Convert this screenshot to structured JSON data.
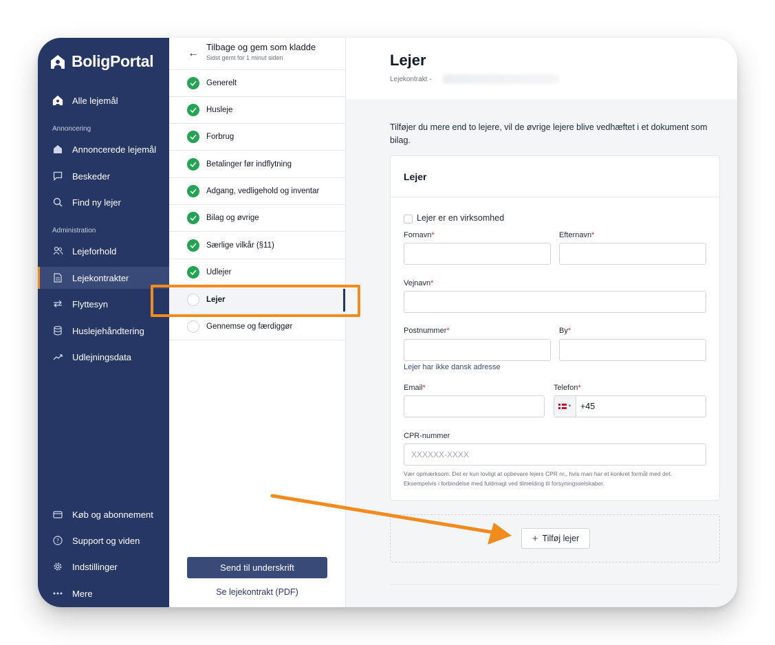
{
  "brand": {
    "name": "BoligPortal",
    "icon": "house-logo-icon"
  },
  "sidebar": {
    "top_item": {
      "label": "Alle lejemål",
      "icon": "home-icon"
    },
    "section_annoncering": "Annoncering",
    "annoncering_items": [
      {
        "label": "Annoncerede lejemål",
        "icon": "house-icon"
      },
      {
        "label": "Beskeder",
        "icon": "chat-icon"
      },
      {
        "label": "Find ny lejer",
        "icon": "search-icon"
      }
    ],
    "section_administration": "Administration",
    "administration_items": [
      {
        "label": "Lejeforhold",
        "icon": "users-icon"
      },
      {
        "label": "Lejekontrakter",
        "icon": "document-icon",
        "active": true
      },
      {
        "label": "Flyttesyn",
        "icon": "swap-icon"
      },
      {
        "label": "Huslejehåndtering",
        "icon": "database-icon"
      },
      {
        "label": "Udlejningsdata",
        "icon": "trend-icon"
      }
    ],
    "bottom_items": [
      {
        "label": "Køb og abonnement",
        "icon": "card-icon"
      },
      {
        "label": "Support og viden",
        "icon": "help-icon"
      },
      {
        "label": "Indstillinger",
        "icon": "gear-icon"
      },
      {
        "label": "Mere",
        "icon": "more-icon"
      }
    ]
  },
  "steps": {
    "back_label": "Tilbage og gem som kladde",
    "saved_label": "Sidst gemt for 1 minut siden",
    "items": [
      {
        "label": "Generelt",
        "done": true
      },
      {
        "label": "Husleje",
        "done": true
      },
      {
        "label": "Forbrug",
        "done": true
      },
      {
        "label": "Betalinger før indflytning",
        "done": true
      },
      {
        "label": "Adgang, vedligehold og inventar",
        "done": true
      },
      {
        "label": "Bilag og øvrige",
        "done": true
      },
      {
        "label": "Særlige vilkår (§11)",
        "done": true
      },
      {
        "label": "Udlejer",
        "done": true
      },
      {
        "label": "Lejer",
        "done": false,
        "current": true
      },
      {
        "label": "Gennemse og færdiggør",
        "done": false
      }
    ],
    "send_button": "Send til underskrift",
    "pdf_link": "Se lejekontrakt (PDF)"
  },
  "main": {
    "title": "Lejer",
    "subtitle": "Lejekontrakt -",
    "intro": "Tilføjer du mere end to lejere, vil de øvrige lejere blive vedhæftet i et dokument som bilag.",
    "card_title": "Lejer",
    "company_checkbox": "Lejer er en virksomhed",
    "fields": {
      "fornavn": "Fornavn",
      "efternavn": "Efternavn",
      "vejnavn": "Vejnavn",
      "postnummer": "Postnummer",
      "by": "By",
      "email": "Email",
      "telefon": "Telefon",
      "cpr": "CPR-nummer"
    },
    "required_mark": "*",
    "no_danish_address": "Lejer har ikke dansk adresse",
    "phone_prefix": "+45",
    "cpr_placeholder": "XXXXXX-XXXX",
    "cpr_note": "Vær opmærksom: Det er kun lovligt at opbevare lejers CPR nr., hvis man har et konkret formål med det. Eksempelvis i forbindelse med fuldmagt ved tilmelding til forsyningsselskaber.",
    "add_tenant_button": "Tilføj lejer"
  },
  "annotation": {
    "highlight_color": "#f28b1e"
  }
}
